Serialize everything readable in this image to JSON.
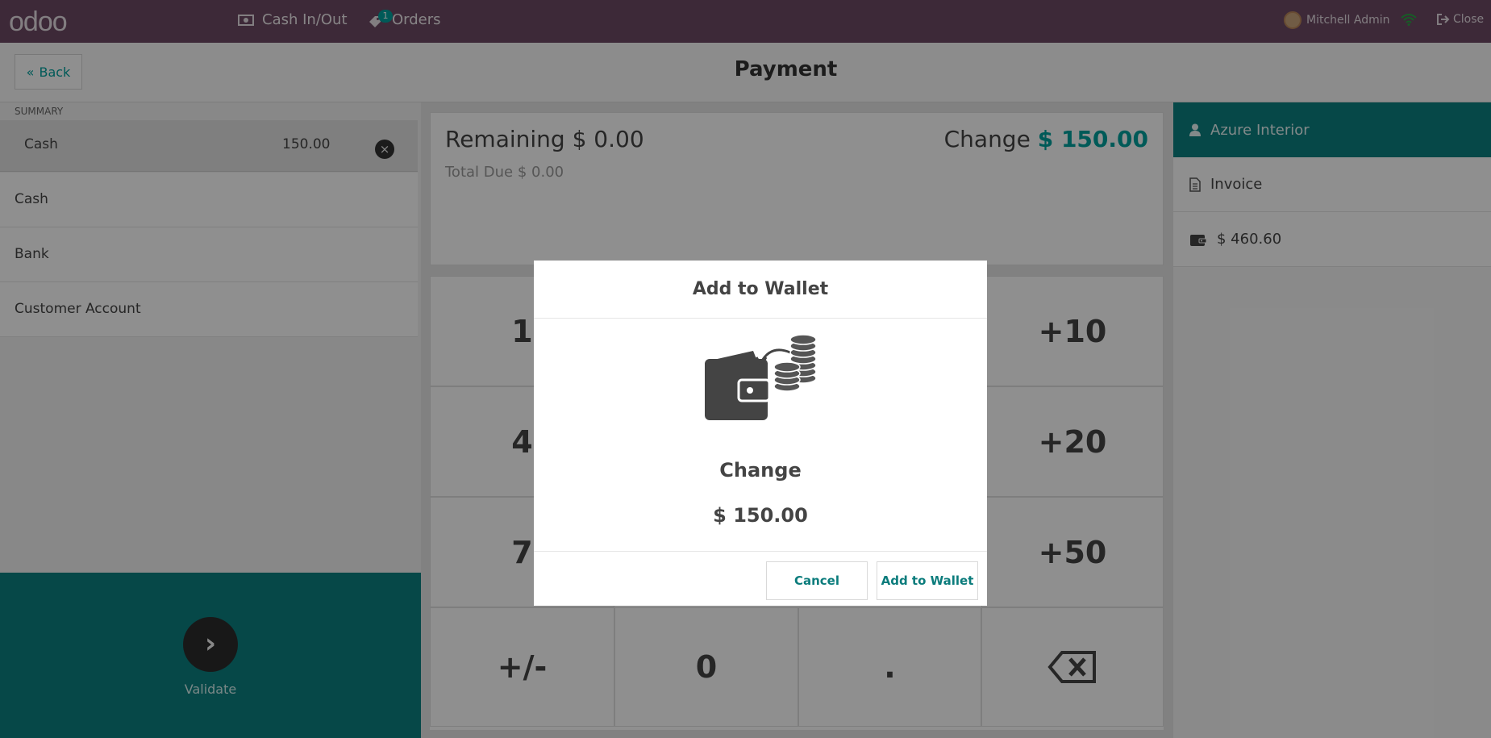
{
  "topbar": {
    "logo": "odoo",
    "cash_in_out": "Cash In/Out",
    "orders": "Orders",
    "orders_badge": "1",
    "user": "Mitchell Admin",
    "close": "Close"
  },
  "header": {
    "back": "Back",
    "title": "Payment"
  },
  "summary": {
    "label": "SUMMARY",
    "lines": [
      {
        "name": "Cash",
        "amount": "150.00"
      }
    ]
  },
  "payment_methods": [
    "Cash",
    "Bank",
    "Customer Account"
  ],
  "validate_label": "Validate",
  "status": {
    "remaining_label": "Remaining",
    "remaining_value": "$ 0.00",
    "total_due_label": "Total Due",
    "total_due_value": "$ 0.00",
    "change_label": "Change",
    "change_value": "$ 150.00"
  },
  "numpad": {
    "keys": [
      "1",
      "+10",
      "4",
      "+20",
      "7",
      "+50",
      "+/-",
      "0",
      ".",
      "backspace"
    ]
  },
  "customer": {
    "name": "Azure Interior",
    "invoice": "Invoice",
    "wallet_balance": "$ 460.60"
  },
  "modal": {
    "title": "Add to Wallet",
    "change_label": "Change",
    "change_amount": "$ 150.00",
    "cancel": "Cancel",
    "confirm": "Add to Wallet"
  },
  "colors": {
    "topbar": "#6e4a64",
    "accent": "#00a09d",
    "validate_bg": "#0b8080"
  }
}
